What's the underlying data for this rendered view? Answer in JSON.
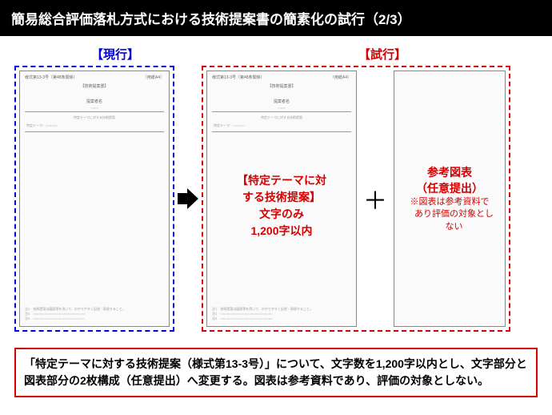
{
  "header": {
    "title": "簡易総合評価落札方式における技術提案書の簡素化の試行（2/3）"
  },
  "labels": {
    "current": "【現行】",
    "trial": "【試行】"
  },
  "tiny": {
    "head_left": "様式第13-3号（第48条関係）",
    "head_right": "（用紙A4）",
    "title": "【技術提案書】",
    "sub": "提案者名",
    "line1": "○○○○",
    "section": "特定テーマに対する技術提案",
    "section2": "特定テーマ：○○○○○○",
    "foot": "注1　技術提案は図面等を用いて、わかりやすく記述・表現すること。\n注2　○○○○○○○○○○○○○○○○○○○○○○○○○○○\n注3　○○○○○○○○○○○○○○○○○○○○○○○○○○○"
  },
  "trial_a": {
    "body_l1": "【特定テーマに対",
    "body_l2": "する技術提案】",
    "body_l3": "文字のみ",
    "body_l4": "1,200字以内"
  },
  "trial_b": {
    "title": "参考図表",
    "sub1": "（任意提出）",
    "note1": "※図表は参考資料で",
    "note2": "　あり評価の対象とし",
    "note3": "　ない"
  },
  "bottom": {
    "text": "「特定テーマに対する技術提案（様式第13-3号）」について、文字数を1,200字以内とし、文字部分と図表部分の2枚構成（任意提出）へ変更する。図表は参考資料であり、評価の対象としない。"
  }
}
